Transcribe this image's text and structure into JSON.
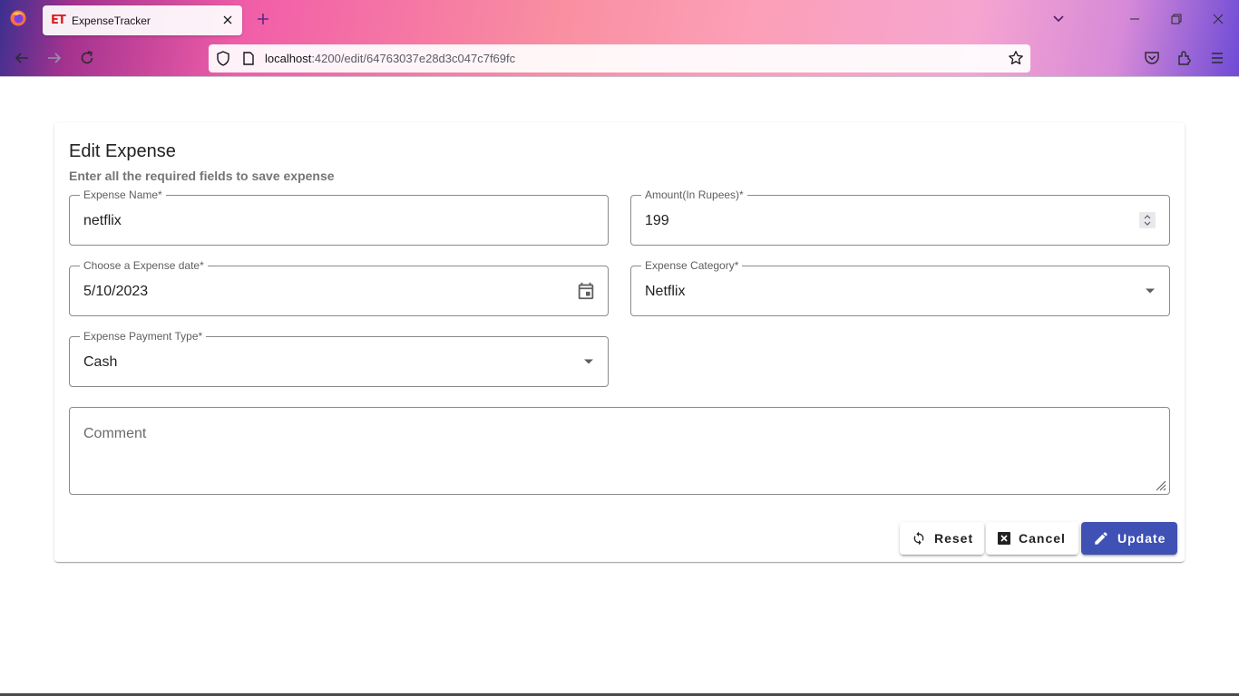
{
  "browser": {
    "tab_title": "ExpenseTracker",
    "tab_favicon_text": "ET",
    "url_host": "localhost",
    "url_path": ":4200/edit/64763037e28d3c047c7f69fc"
  },
  "form": {
    "title": "Edit Expense",
    "subtitle": "Enter all the required fields to save expense",
    "expense_name": {
      "label": "Expense Name*",
      "value": "netflix"
    },
    "amount": {
      "label": "Amount(In Rupees)*",
      "value": "199"
    },
    "expense_date": {
      "label": "Choose a Expense date*",
      "value": "5/10/2023"
    },
    "category": {
      "label": "Expense Category*",
      "value": "Netflix"
    },
    "payment_type": {
      "label": "Expense Payment Type*",
      "value": "Cash"
    },
    "comment": {
      "placeholder": "Comment"
    }
  },
  "actions": {
    "reset_label": "Reset",
    "cancel_label": "Cancel",
    "update_label": "Update"
  },
  "colors": {
    "primary": "#3f51b5",
    "outline": "#8a8a8a"
  },
  "icons": [
    "firefox-icon",
    "close-icon",
    "plus-icon",
    "chevron-down-icon",
    "minimize-icon",
    "restore-icon",
    "back-icon",
    "forward-icon",
    "reload-icon",
    "shield-icon",
    "page-icon",
    "star-icon",
    "pocket-icon",
    "extensions-icon",
    "menu-icon",
    "calendar-icon",
    "spinner-icon",
    "dropdown-arrow-icon",
    "refresh-icon",
    "cancel-box-icon",
    "pencil-icon"
  ]
}
